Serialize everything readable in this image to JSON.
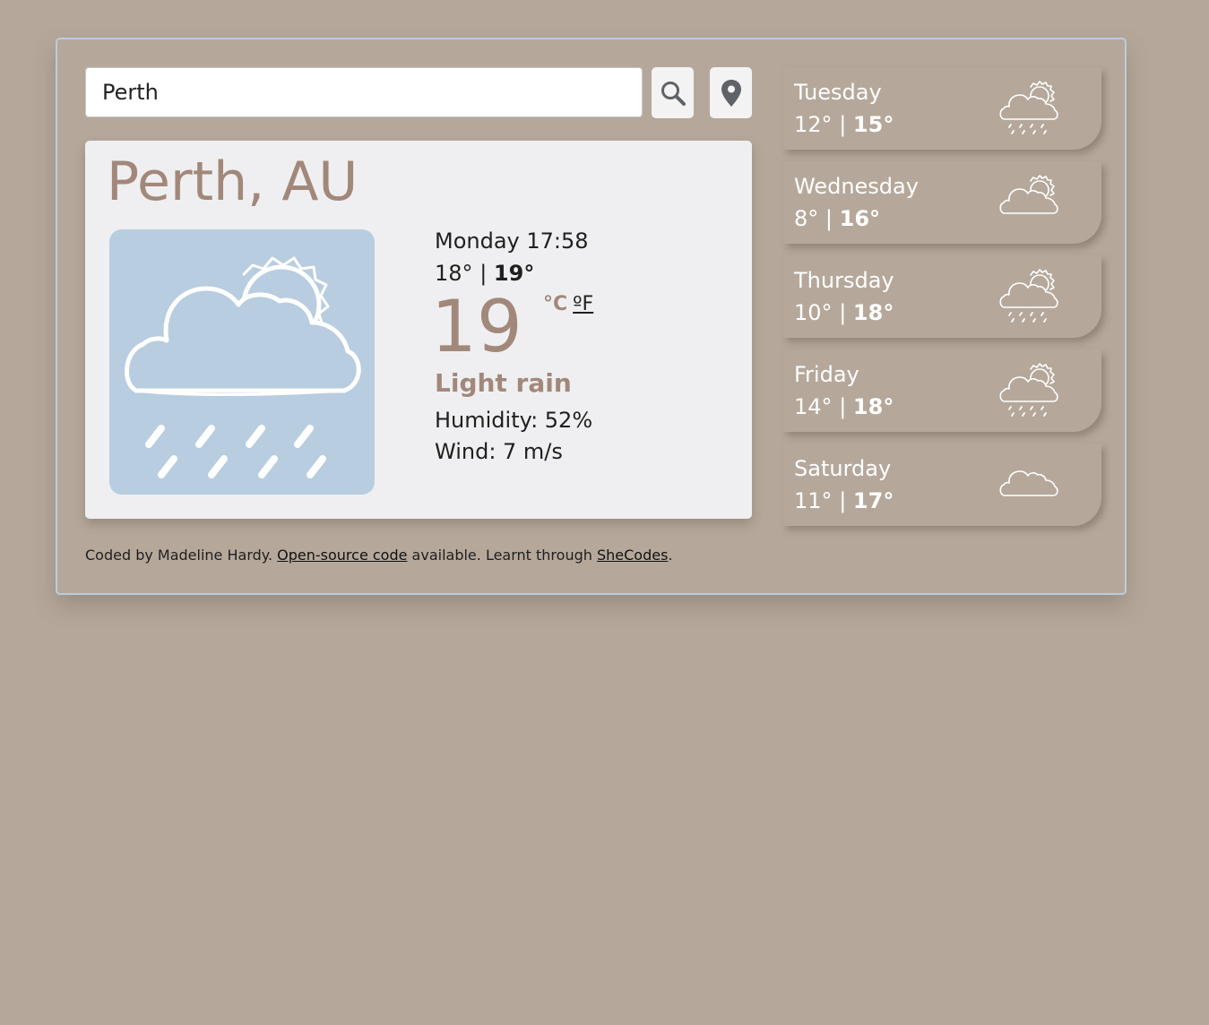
{
  "search": {
    "value": "Perth"
  },
  "current": {
    "city": "Perth, AU",
    "datetime": "Monday 17:58",
    "min": "18°",
    "separator": "|",
    "max": "19°",
    "temperature": "19",
    "unit_celsius": "°C",
    "unit_fahrenheit": "ºF",
    "description": "Light rain",
    "humidity": "Humidity: 52%",
    "wind": "Wind: 7 m/s",
    "icon": "sun-behind-rain-cloud-icon"
  },
  "forecast": [
    {
      "day": "Tuesday",
      "min": "12°",
      "max": "15°",
      "icon": "sun-behind-rain-cloud-icon"
    },
    {
      "day": "Wednesday",
      "min": "8°",
      "max": "16°",
      "icon": "sun-behind-cloud-icon"
    },
    {
      "day": "Thursday",
      "min": "10°",
      "max": "18°",
      "icon": "sun-behind-rain-cloud-icon"
    },
    {
      "day": "Friday",
      "min": "14°",
      "max": "18°",
      "icon": "sun-behind-rain-cloud-icon"
    },
    {
      "day": "Saturday",
      "min": "11°",
      "max": "17°",
      "icon": "cloud-icon"
    }
  ],
  "footer": {
    "prefix": "Coded by Madeline Hardy.",
    "link1": "Open-source code",
    "middle": "available. Learnt through",
    "link2": "SheCodes",
    "suffix": "."
  },
  "colors": {
    "background": "#b5a89b",
    "accent": "#a2887a",
    "card": "#efeff1",
    "icon_tile": "#b8cde0"
  }
}
